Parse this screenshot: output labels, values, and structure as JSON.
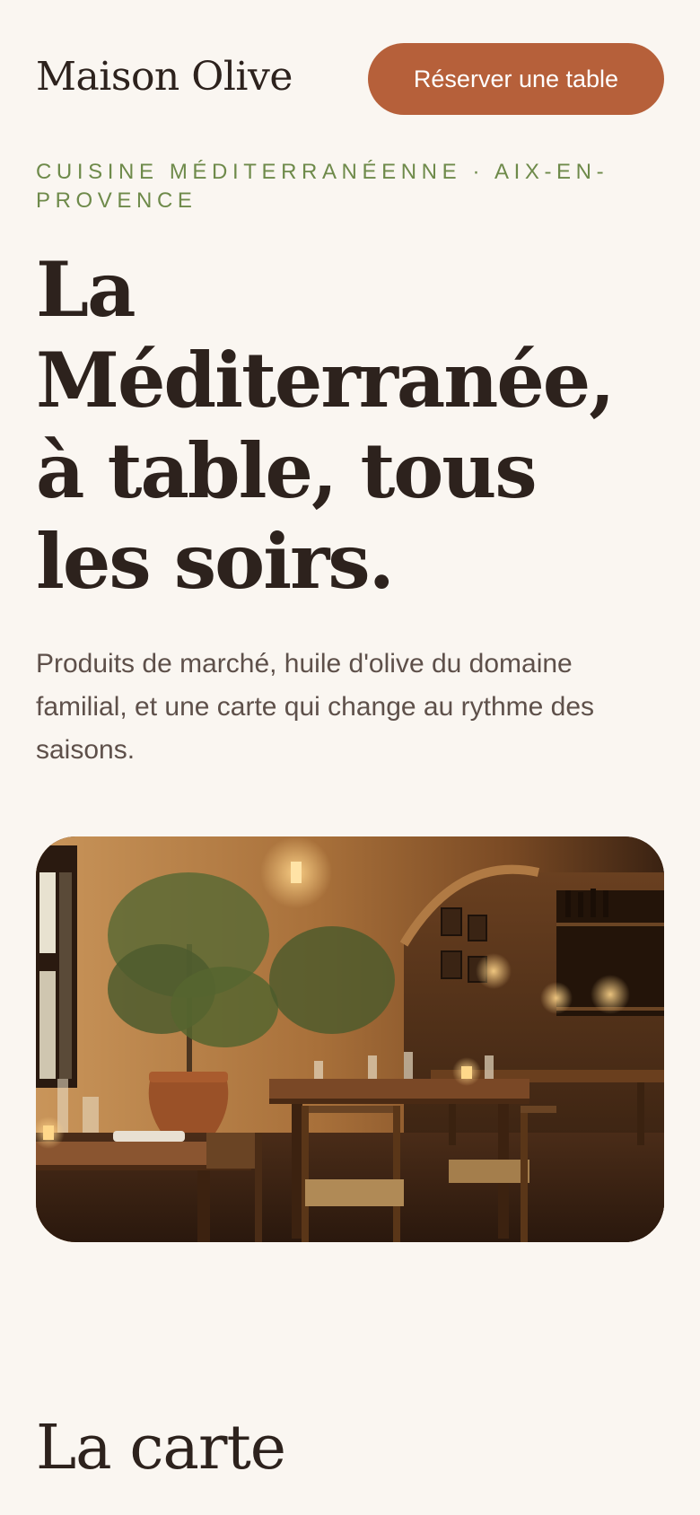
{
  "header": {
    "logo": "Maison Olive",
    "cta_label": "Réserver une table"
  },
  "hero": {
    "eyebrow": "Cuisine méditerranéenne · Aix-en-Provence",
    "title": "La Méditerranée, à table, tous les soirs.",
    "lead": "Produits de marché, huile d'olive du domaine familial, et une carte qui change au rythme des saisons."
  },
  "image": {
    "subject": "restaurant-dining-room"
  },
  "menu_section": {
    "title": "La carte"
  },
  "colors": {
    "background": "#faf6f1",
    "accent": "#b6603a",
    "eyebrow": "#6e8a4a",
    "text": "#2d221d",
    "muted_text": "#5e504a"
  }
}
